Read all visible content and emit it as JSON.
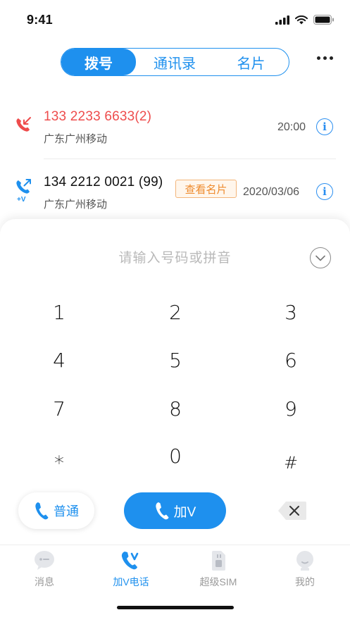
{
  "status_bar": {
    "time": "9:41"
  },
  "top_nav": {
    "tabs": [
      {
        "label": "拨号",
        "active": true
      },
      {
        "label": "通讯录",
        "active": false
      },
      {
        "label": "名片",
        "active": false
      }
    ],
    "more_icon": "more-dots-icon"
  },
  "call_log": [
    {
      "number": "133 2233 6633(2)",
      "carrier": "广东广州移动",
      "time": "20:00",
      "type": "missed",
      "number_color": "#ee4c4c",
      "icon": "missed-call-icon"
    },
    {
      "number": "134 2212 0021 (99)",
      "carrier": "广东广州移动",
      "time": "2020/03/06",
      "type": "outgoing-v",
      "icon_badge": "+V",
      "badge_label": "查看名片",
      "icon": "outgoing-call-icon"
    }
  ],
  "dialpad": {
    "placeholder": "请输入号码或拼音",
    "keys": [
      "1",
      "2",
      "3",
      "4",
      "5",
      "6",
      "7",
      "8",
      "9",
      "*",
      "0",
      "#"
    ],
    "normal_call_label": "普通",
    "v_call_label": "加V"
  },
  "tabbar": {
    "items": [
      {
        "label": "消息",
        "icon": "message-bubble-icon",
        "active": false
      },
      {
        "label": "加V电话",
        "icon": "phone-v-icon",
        "active": true
      },
      {
        "label": "超级SIM",
        "icon": "sim-card-icon",
        "active": false
      },
      {
        "label": "我的",
        "icon": "profile-icon",
        "active": false
      }
    ]
  },
  "colors": {
    "accent": "#1e90ee",
    "missed": "#ee4c4c",
    "badge": "#ee8a2c"
  }
}
